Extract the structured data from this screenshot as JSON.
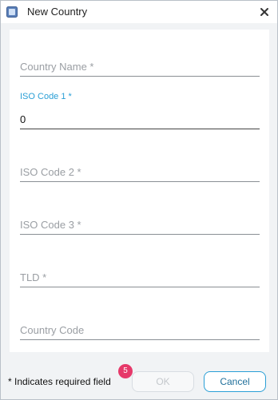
{
  "window": {
    "title": "New Country"
  },
  "form": {
    "country_name": {
      "placeholder": "Country Name *",
      "value": ""
    },
    "iso_code_1": {
      "label": "ISO Code 1 *",
      "value": "0"
    },
    "iso_code_2": {
      "placeholder": "ISO Code 2 *",
      "value": ""
    },
    "iso_code_3": {
      "placeholder": "ISO Code 3 *",
      "value": ""
    },
    "tld": {
      "placeholder": "TLD *",
      "value": ""
    },
    "country_code": {
      "placeholder": "Country Code",
      "value": ""
    }
  },
  "footer": {
    "required_note": "* Indicates required field",
    "badge_count": "5",
    "ok_label": "OK",
    "cancel_label": "Cancel"
  },
  "colors": {
    "accent": "#2a9fd6",
    "badge": "#e6396a",
    "panel_bg": "#ffffff",
    "window_bg": "#f1f3f5"
  },
  "icons": {
    "app": "app-window-icon",
    "close": "close-icon"
  }
}
